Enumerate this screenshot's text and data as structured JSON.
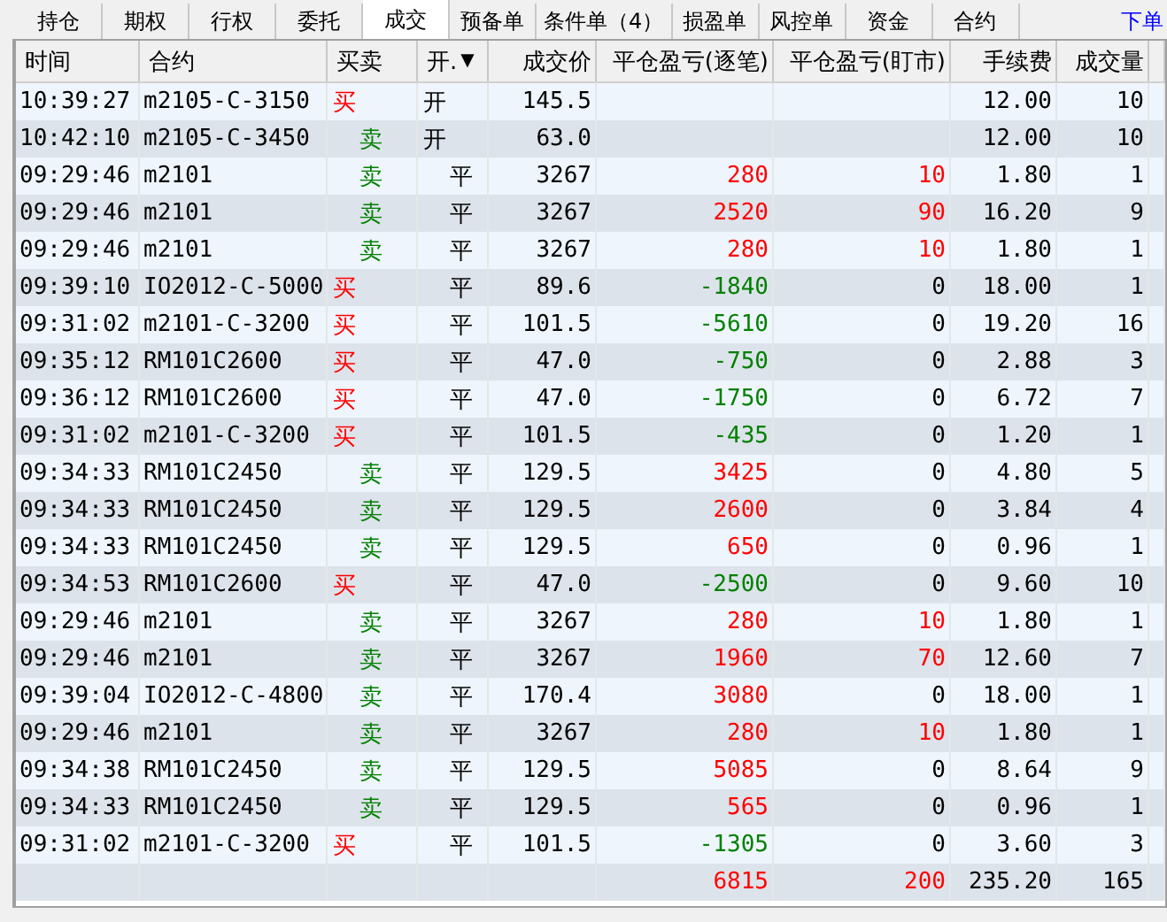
{
  "tabs": [
    {
      "label": "持仓",
      "selected": false
    },
    {
      "label": "期权",
      "selected": false
    },
    {
      "label": "行权",
      "selected": false
    },
    {
      "label": "委托",
      "selected": false
    },
    {
      "label": "成交",
      "selected": true
    },
    {
      "label": "预备单",
      "selected": false
    },
    {
      "label": "条件单（4）",
      "selected": false
    },
    {
      "label": "损盈单",
      "selected": false
    },
    {
      "label": "风控单",
      "selected": false
    },
    {
      "label": "资金",
      "selected": false
    },
    {
      "label": "合约",
      "selected": false
    }
  ],
  "order_link": "下单",
  "columns": [
    {
      "label": "时间"
    },
    {
      "label": "合约"
    },
    {
      "label": "买卖"
    },
    {
      "label": "开.",
      "sort_mark": "▼"
    },
    {
      "label": "成交价"
    },
    {
      "label": "平仓盈亏(逐笔)"
    },
    {
      "label": "平仓盈亏(盯市)"
    },
    {
      "label": "手续费"
    },
    {
      "label": "成交量"
    }
  ],
  "rows": [
    {
      "time": "10:39:27",
      "contract": "m2105-C-3150",
      "side": {
        "text": "买",
        "kind": "buy"
      },
      "offset": {
        "text": "开",
        "kind": "open"
      },
      "price": "145.5",
      "fee": "12.00",
      "volume": "10"
    },
    {
      "time": "10:42:10",
      "contract": "m2105-C-3450",
      "side": {
        "text": "卖",
        "kind": "sell"
      },
      "offset": {
        "text": "开",
        "kind": "open"
      },
      "price": "63.0",
      "fee": "12.00",
      "volume": "10"
    },
    {
      "time": "09:29:46",
      "contract": "m2101",
      "side": {
        "text": "卖",
        "kind": "sell"
      },
      "offset": {
        "text": "平",
        "kind": "close"
      },
      "price": "3267",
      "pnl_trade": {
        "text": "280",
        "color": "#ff0000"
      },
      "pnl_mark": {
        "text": "10",
        "color": "#ff0000"
      },
      "fee": "1.80",
      "volume": "1"
    },
    {
      "time": "09:29:46",
      "contract": "m2101",
      "side": {
        "text": "卖",
        "kind": "sell"
      },
      "offset": {
        "text": "平",
        "kind": "close"
      },
      "price": "3267",
      "pnl_trade": {
        "text": "2520",
        "color": "#ff0000"
      },
      "pnl_mark": {
        "text": "90",
        "color": "#ff0000"
      },
      "fee": "16.20",
      "volume": "9"
    },
    {
      "time": "09:29:46",
      "contract": "m2101",
      "side": {
        "text": "卖",
        "kind": "sell"
      },
      "offset": {
        "text": "平",
        "kind": "close"
      },
      "price": "3267",
      "pnl_trade": {
        "text": "280",
        "color": "#ff0000"
      },
      "pnl_mark": {
        "text": "10",
        "color": "#ff0000"
      },
      "fee": "1.80",
      "volume": "1"
    },
    {
      "time": "09:39:10",
      "contract": "IO2012-C-5000",
      "side": {
        "text": "买",
        "kind": "buy"
      },
      "offset": {
        "text": "平",
        "kind": "close"
      },
      "price": "89.6",
      "pnl_trade": {
        "text": "-1840",
        "color": "#008000"
      },
      "pnl_mark": {
        "text": "0",
        "color": "#000000"
      },
      "fee": "18.00",
      "volume": "1"
    },
    {
      "time": "09:31:02",
      "contract": "m2101-C-3200",
      "side": {
        "text": "买",
        "kind": "buy"
      },
      "offset": {
        "text": "平",
        "kind": "close"
      },
      "price": "101.5",
      "pnl_trade": {
        "text": "-5610",
        "color": "#008000"
      },
      "pnl_mark": {
        "text": "0",
        "color": "#000000"
      },
      "fee": "19.20",
      "volume": "16"
    },
    {
      "time": "09:35:12",
      "contract": "RM101C2600",
      "side": {
        "text": "买",
        "kind": "buy"
      },
      "offset": {
        "text": "平",
        "kind": "close"
      },
      "price": "47.0",
      "pnl_trade": {
        "text": "-750",
        "color": "#008000"
      },
      "pnl_mark": {
        "text": "0",
        "color": "#000000"
      },
      "fee": "2.88",
      "volume": "3"
    },
    {
      "time": "09:36:12",
      "contract": "RM101C2600",
      "side": {
        "text": "买",
        "kind": "buy"
      },
      "offset": {
        "text": "平",
        "kind": "close"
      },
      "price": "47.0",
      "pnl_trade": {
        "text": "-1750",
        "color": "#008000"
      },
      "pnl_mark": {
        "text": "0",
        "color": "#000000"
      },
      "fee": "6.72",
      "volume": "7"
    },
    {
      "time": "09:31:02",
      "contract": "m2101-C-3200",
      "side": {
        "text": "买",
        "kind": "buy"
      },
      "offset": {
        "text": "平",
        "kind": "close"
      },
      "price": "101.5",
      "pnl_trade": {
        "text": "-435",
        "color": "#008000"
      },
      "pnl_mark": {
        "text": "0",
        "color": "#000000"
      },
      "fee": "1.20",
      "volume": "1"
    },
    {
      "time": "09:34:33",
      "contract": "RM101C2450",
      "side": {
        "text": "卖",
        "kind": "sell"
      },
      "offset": {
        "text": "平",
        "kind": "close"
      },
      "price": "129.5",
      "pnl_trade": {
        "text": "3425",
        "color": "#ff0000"
      },
      "pnl_mark": {
        "text": "0",
        "color": "#000000"
      },
      "fee": "4.80",
      "volume": "5"
    },
    {
      "time": "09:34:33",
      "contract": "RM101C2450",
      "side": {
        "text": "卖",
        "kind": "sell"
      },
      "offset": {
        "text": "平",
        "kind": "close"
      },
      "price": "129.5",
      "pnl_trade": {
        "text": "2600",
        "color": "#ff0000"
      },
      "pnl_mark": {
        "text": "0",
        "color": "#000000"
      },
      "fee": "3.84",
      "volume": "4"
    },
    {
      "time": "09:34:33",
      "contract": "RM101C2450",
      "side": {
        "text": "卖",
        "kind": "sell"
      },
      "offset": {
        "text": "平",
        "kind": "close"
      },
      "price": "129.5",
      "pnl_trade": {
        "text": "650",
        "color": "#ff0000"
      },
      "pnl_mark": {
        "text": "0",
        "color": "#000000"
      },
      "fee": "0.96",
      "volume": "1"
    },
    {
      "time": "09:34:53",
      "contract": "RM101C2600",
      "side": {
        "text": "买",
        "kind": "buy"
      },
      "offset": {
        "text": "平",
        "kind": "close"
      },
      "price": "47.0",
      "pnl_trade": {
        "text": "-2500",
        "color": "#008000"
      },
      "pnl_mark": {
        "text": "0",
        "color": "#000000"
      },
      "fee": "9.60",
      "volume": "10"
    },
    {
      "time": "09:29:46",
      "contract": "m2101",
      "side": {
        "text": "卖",
        "kind": "sell"
      },
      "offset": {
        "text": "平",
        "kind": "close"
      },
      "price": "3267",
      "pnl_trade": {
        "text": "280",
        "color": "#ff0000"
      },
      "pnl_mark": {
        "text": "10",
        "color": "#ff0000"
      },
      "fee": "1.80",
      "volume": "1"
    },
    {
      "time": "09:29:46",
      "contract": "m2101",
      "side": {
        "text": "卖",
        "kind": "sell"
      },
      "offset": {
        "text": "平",
        "kind": "close"
      },
      "price": "3267",
      "pnl_trade": {
        "text": "1960",
        "color": "#ff0000"
      },
      "pnl_mark": {
        "text": "70",
        "color": "#ff0000"
      },
      "fee": "12.60",
      "volume": "7"
    },
    {
      "time": "09:39:04",
      "contract": "IO2012-C-4800",
      "side": {
        "text": "卖",
        "kind": "sell"
      },
      "offset": {
        "text": "平",
        "kind": "close"
      },
      "price": "170.4",
      "pnl_trade": {
        "text": "3080",
        "color": "#ff0000"
      },
      "pnl_mark": {
        "text": "0",
        "color": "#000000"
      },
      "fee": "18.00",
      "volume": "1"
    },
    {
      "time": "09:29:46",
      "contract": "m2101",
      "side": {
        "text": "卖",
        "kind": "sell"
      },
      "offset": {
        "text": "平",
        "kind": "close"
      },
      "price": "3267",
      "pnl_trade": {
        "text": "280",
        "color": "#ff0000"
      },
      "pnl_mark": {
        "text": "10",
        "color": "#ff0000"
      },
      "fee": "1.80",
      "volume": "1"
    },
    {
      "time": "09:34:38",
      "contract": "RM101C2450",
      "side": {
        "text": "卖",
        "kind": "sell"
      },
      "offset": {
        "text": "平",
        "kind": "close"
      },
      "price": "129.5",
      "pnl_trade": {
        "text": "5085",
        "color": "#ff0000"
      },
      "pnl_mark": {
        "text": "0",
        "color": "#000000"
      },
      "fee": "8.64",
      "volume": "9"
    },
    {
      "time": "09:34:33",
      "contract": "RM101C2450",
      "side": {
        "text": "卖",
        "kind": "sell"
      },
      "offset": {
        "text": "平",
        "kind": "close"
      },
      "price": "129.5",
      "pnl_trade": {
        "text": "565",
        "color": "#ff0000"
      },
      "pnl_mark": {
        "text": "0",
        "color": "#000000"
      },
      "fee": "0.96",
      "volume": "1"
    },
    {
      "time": "09:31:02",
      "contract": "m2101-C-3200",
      "side": {
        "text": "买",
        "kind": "buy"
      },
      "offset": {
        "text": "平",
        "kind": "close"
      },
      "price": "101.5",
      "pnl_trade": {
        "text": "-1305",
        "color": "#008000"
      },
      "pnl_mark": {
        "text": "0",
        "color": "#000000"
      },
      "fee": "3.60",
      "volume": "3"
    }
  ],
  "totals": {
    "pnl_trade": {
      "text": "6815",
      "color": "#ff0000"
    },
    "pnl_mark": {
      "text": "200",
      "color": "#ff0000"
    },
    "fee": "235.20",
    "volume": "165"
  }
}
